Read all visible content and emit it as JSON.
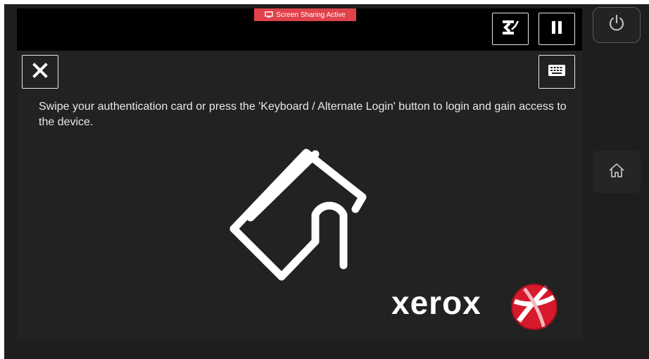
{
  "banner": {
    "label": "Screen Sharing Active",
    "color": "#e0424b"
  },
  "toolbar": {
    "reset_icon": "reset-swap-icon",
    "pause_icon": "pause-icon",
    "close_icon": "close-x-icon",
    "keyboard_icon": "keyboard-icon"
  },
  "main": {
    "instruction": "Swipe your authentication card or press the 'Keyboard / Alternate Login' button to login and gain access to the device.",
    "illustration_icon": "card-swipe-icon"
  },
  "brand": {
    "wordmark": "xerox",
    "logo_color": "#d7192c"
  },
  "side_panel": {
    "power_icon": "power-icon",
    "home_icon": "home-icon"
  }
}
